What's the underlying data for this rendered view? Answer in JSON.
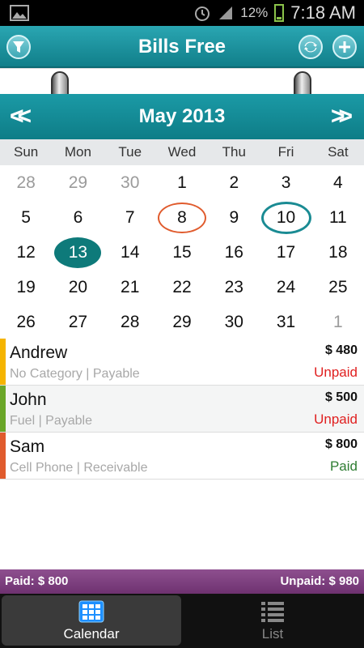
{
  "status_bar": {
    "battery": "12%",
    "time": "7:18 AM"
  },
  "app": {
    "title": "Bills Free"
  },
  "calendar": {
    "month_title": "May 2013",
    "prev_label": "<<",
    "next_label": ">>",
    "weekdays": [
      "Sun",
      "Mon",
      "Tue",
      "Wed",
      "Thu",
      "Fri",
      "Sat"
    ],
    "days": [
      {
        "label": "28",
        "muted": true
      },
      {
        "label": "29",
        "muted": true
      },
      {
        "label": "30",
        "muted": true
      },
      {
        "label": "1"
      },
      {
        "label": "2"
      },
      {
        "label": "3"
      },
      {
        "label": "4"
      },
      {
        "label": "5"
      },
      {
        "label": "6"
      },
      {
        "label": "7"
      },
      {
        "label": "8",
        "mark": "red"
      },
      {
        "label": "9"
      },
      {
        "label": "10",
        "mark": "teal"
      },
      {
        "label": "11"
      },
      {
        "label": "12"
      },
      {
        "label": "13",
        "selected": true
      },
      {
        "label": "14"
      },
      {
        "label": "15"
      },
      {
        "label": "16"
      },
      {
        "label": "17"
      },
      {
        "label": "18"
      },
      {
        "label": "19"
      },
      {
        "label": "20"
      },
      {
        "label": "21"
      },
      {
        "label": "22"
      },
      {
        "label": "23"
      },
      {
        "label": "24"
      },
      {
        "label": "25"
      },
      {
        "label": "26"
      },
      {
        "label": "27"
      },
      {
        "label": "28"
      },
      {
        "label": "29"
      },
      {
        "label": "30"
      },
      {
        "label": "31"
      },
      {
        "label": "1",
        "muted": true
      }
    ]
  },
  "bills": [
    {
      "name": "Andrew",
      "details": "No Category | Payable",
      "amount": "$ 480",
      "status": "Unpaid",
      "stripe_color": "#f5b400",
      "status_color": "#e02020"
    },
    {
      "name": "John",
      "details": "Fuel | Payable",
      "amount": "$ 500",
      "status": "Unpaid",
      "stripe_color": "#6aa628",
      "status_color": "#e02020"
    },
    {
      "name": "Sam",
      "details": "Cell Phone | Receivable",
      "amount": "$ 800",
      "status": "Paid",
      "stripe_color": "#e05b2d",
      "status_color": "#2e7d32"
    }
  ],
  "totals": {
    "paid": "Paid: $ 800",
    "unpaid": "Unpaid: $ 980"
  },
  "tabs": {
    "calendar": "Calendar",
    "list": "List"
  }
}
